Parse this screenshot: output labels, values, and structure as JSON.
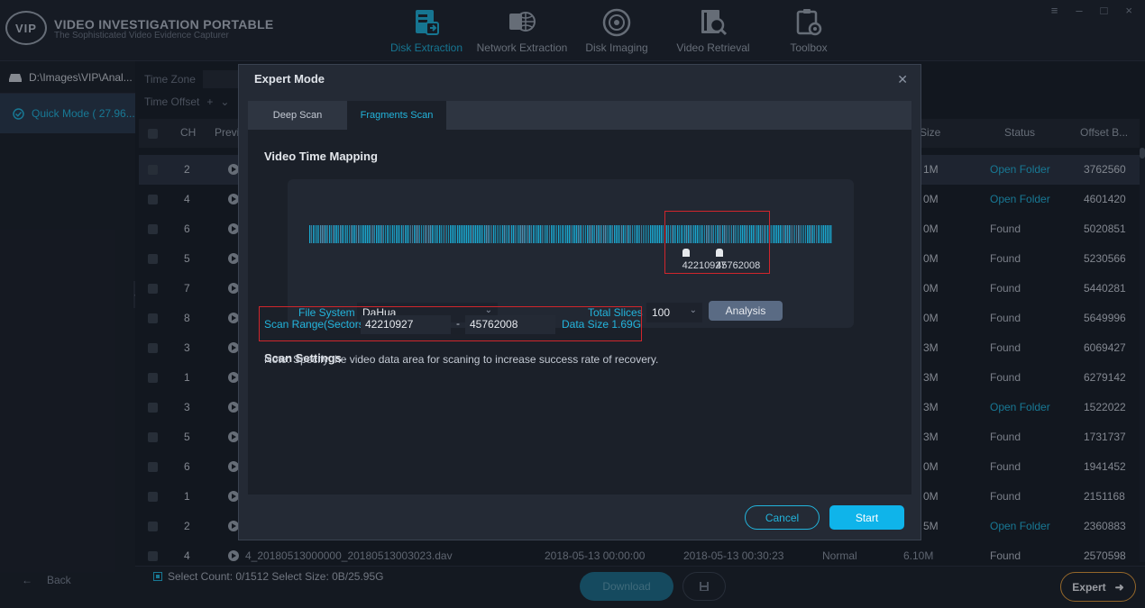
{
  "app": {
    "title": "VIDEO INVESTIGATION PORTABLE",
    "subtitle": "The Sophisticated Video Evidence Capturer",
    "logo_text": "VIP",
    "window_controls": [
      "≡",
      "–",
      "□",
      "×"
    ]
  },
  "nav": [
    {
      "label": "Disk Extraction",
      "icon": "disk-extraction-icon",
      "active": true
    },
    {
      "label": "Network Extraction",
      "icon": "network-extraction-icon",
      "active": false
    },
    {
      "label": "Disk Imaging",
      "icon": "disk-imaging-icon",
      "active": false
    },
    {
      "label": "Video Retrieval",
      "icon": "video-retrieval-icon",
      "active": false
    },
    {
      "label": "Toolbox",
      "icon": "toolbox-icon",
      "active": false
    }
  ],
  "sidebar": {
    "path": "D:\\Images\\VIP\\Anal...",
    "quick_mode": "Quick Mode ( 27.96...",
    "back": "Back"
  },
  "filters": {
    "time_zone_label": "Time Zone",
    "time_offset_label": "Time Offset",
    "time_offset_sign": "+"
  },
  "table": {
    "headers": {
      "ch": "CH",
      "preview": "Previ",
      "size": "Size",
      "status": "Status",
      "offset": "Offset B..."
    },
    "rows": [
      {
        "ch": "2",
        "size": "1M",
        "status": "Open Folder",
        "offset": "3762560",
        "selected": true
      },
      {
        "ch": "4",
        "size": "0M",
        "status": "Open Folder",
        "offset": "4601420"
      },
      {
        "ch": "6",
        "size": "0M",
        "status": "Found",
        "offset": "5020851"
      },
      {
        "ch": "5",
        "size": "0M",
        "status": "Found",
        "offset": "5230566"
      },
      {
        "ch": "7",
        "size": "0M",
        "status": "Found",
        "offset": "5440281"
      },
      {
        "ch": "8",
        "size": "0M",
        "status": "Found",
        "offset": "5649996"
      },
      {
        "ch": "3",
        "size": "3M",
        "status": "Found",
        "offset": "6069427"
      },
      {
        "ch": "1",
        "size": "3M",
        "status": "Found",
        "offset": "6279142"
      },
      {
        "ch": "3",
        "size": "3M",
        "status": "Open Folder",
        "offset": "1522022"
      },
      {
        "ch": "5",
        "size": "3M",
        "status": "Found",
        "offset": "1731737"
      },
      {
        "ch": "6",
        "size": "0M",
        "status": "Found",
        "offset": "1941452"
      },
      {
        "ch": "1",
        "size": "0M",
        "status": "Found",
        "offset": "2151168"
      },
      {
        "ch": "2",
        "size": "5M",
        "status": "Open Folder",
        "offset": "2360883"
      },
      {
        "ch": "4",
        "name": "4_20180513000000_20180513003023.dav",
        "start": "2018-05-13 00:00:00",
        "end": "2018-05-13 00:30:23",
        "type": "Normal",
        "size": "6.10M",
        "status": "Found",
        "offset": "2570598"
      }
    ]
  },
  "bottom": {
    "select_info": "Select Count: 0/1512 Select Size: 0B/25.95G",
    "download": "Download",
    "expert": "Expert"
  },
  "modal": {
    "title": "Expert Mode",
    "tabs": [
      {
        "label": "Deep Scan",
        "active": false
      },
      {
        "label": "Fragments Scan",
        "active": true
      }
    ],
    "mapping_title": "Video Time Mapping",
    "marker_start": "42210927",
    "marker_end": "45762008",
    "marker_start_fraction": 0.72,
    "marker_end_fraction": 0.785,
    "file_system_label": "File System",
    "file_system_value": "DaHua",
    "total_slices_label": "Total Slices",
    "total_slices_value": "100",
    "analysis_button": "Analysis",
    "scan_settings_title": "Scan Settings",
    "scan_range_label": "Scan Range(Sectors)",
    "scan_range_start": "42210927",
    "scan_range_end": "45762008",
    "range_separator": "-",
    "data_size": "Data Size 1.69G",
    "note": "Note: Specify the video data area for scaning to increase success rate of recovery.",
    "cancel": "Cancel",
    "start": "Start"
  },
  "colors": {
    "accent": "#22b4dc",
    "highlight_red": "#d0262c",
    "expert_border": "#e09a3a"
  }
}
